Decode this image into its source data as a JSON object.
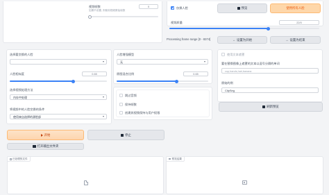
{
  "top_left": {
    "title": "视频帧数",
    "hint": "如果不设置, 则使用视频原始帧数",
    "value": "0"
  },
  "top_right": {
    "keep_face_label": "仅换人脸",
    "keep_face_checked": true,
    "preview_button": "预览",
    "use_pro_button": "使用所有人脸",
    "video_quality_label": "视频质量",
    "video_quality_value": "22/0",
    "processing_range_label": "Processing frame range [0 - 8374]",
    "set_start_button": "设置为开始",
    "set_end_button": "设置为结束"
  },
  "col1": {
    "select_face_label": "选择要交换的人脸",
    "select_face_value": "",
    "similarity_label": "人脸相似度",
    "similarity_value": "0.65",
    "similarity_fraction": 0.65,
    "select_mode_label": "选择视频处理方法",
    "select_mode_value": "内存中处理",
    "face_swap_condition_label": "将视频中的人脸交换的条件",
    "face_swap_condition_value": "使用来自选择的源脸部"
  },
  "col2": {
    "enhance_label": "人脸增强模型",
    "enhance_value": "无",
    "blend_label": "原图混合比例",
    "blend_value": "0.65",
    "blend_fraction": 0.65,
    "options": [
      {
        "label": "跳过音频",
        "checked": false
      },
      {
        "label": "保持帧数",
        "checked": false
      },
      {
        "label": "创建其视频保持与用户权限",
        "checked": false
      }
    ]
  },
  "col3": {
    "use_text_mask_label": "使用文本遮罩",
    "text_mask_hint_label": "要在替换图像上遮罩的文本以逗号分隔的单词",
    "text_mask_placeholder": "cup,hands,hair,banana",
    "clip_label": "原始的例",
    "clip_value": "ClipSeg",
    "refresh_button": "刷新预览"
  },
  "actions": {
    "start_button": "开始",
    "stop_button": "停止",
    "open_folder_button": "打开输出文件夹"
  },
  "bottom": {
    "processed_label": "已处理的文件",
    "preview_label": "预览结果"
  },
  "colors": {
    "accent": "#3b82f6",
    "orange": "#ea580c",
    "panel": "#ffffff",
    "background": "#f3f4f6"
  }
}
